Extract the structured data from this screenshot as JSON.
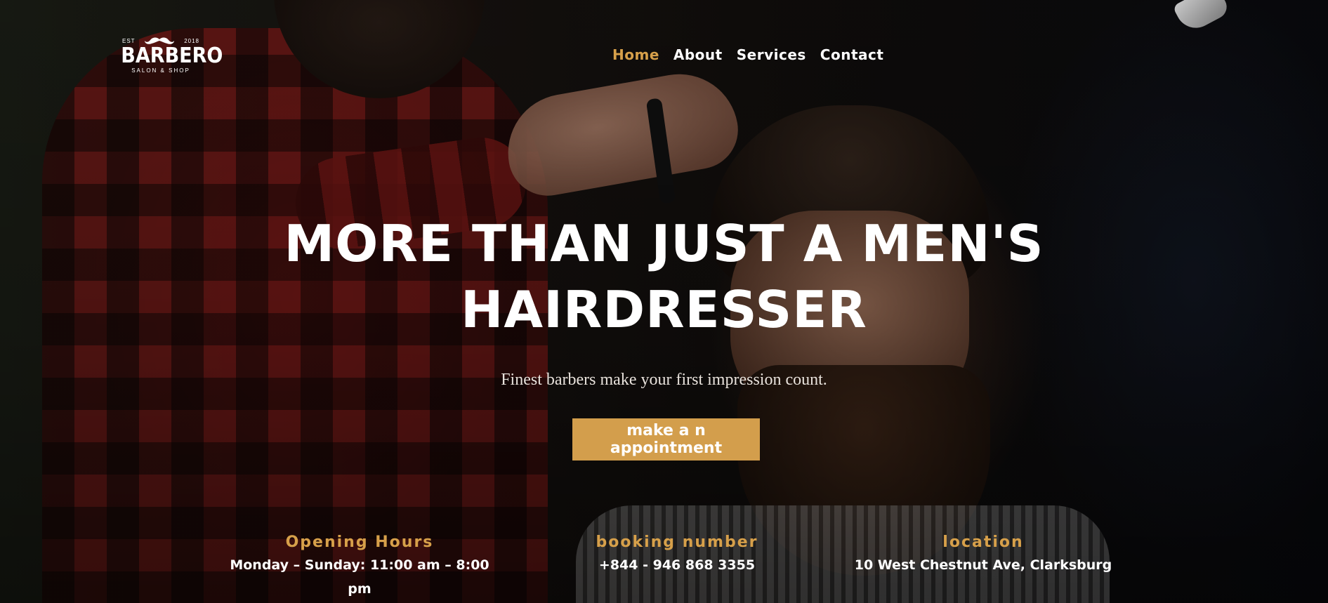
{
  "brand": {
    "est": "EST",
    "year": "2018",
    "name": "BARBERO",
    "tagline": "SALON & SHOP",
    "logo_icon": "mustache-icon"
  },
  "nav": {
    "items": [
      {
        "label": "Home",
        "active": true
      },
      {
        "label": "About",
        "active": false
      },
      {
        "label": "Services",
        "active": false
      },
      {
        "label": "Contact",
        "active": false
      }
    ]
  },
  "hero": {
    "headline_line1": "MORE THAN JUST A MEN'S",
    "headline_line2": "HAIRDRESSER",
    "subtitle": "Finest barbers make your first impression count.",
    "cta_label": "make a n appointment"
  },
  "info": {
    "hours_title": "Opening Hours",
    "hours_value": "Monday – Sunday: 11:00 am – 8:00 pm",
    "booking_title": "booking number",
    "booking_value": "+844 - 946 868 3355",
    "location_title": "location",
    "location_value": "10 West Chestnut Ave, Clarksburg"
  },
  "colors": {
    "accent": "#d7a04a",
    "cta_background": "#d39e4c",
    "text": "#ffffff"
  }
}
